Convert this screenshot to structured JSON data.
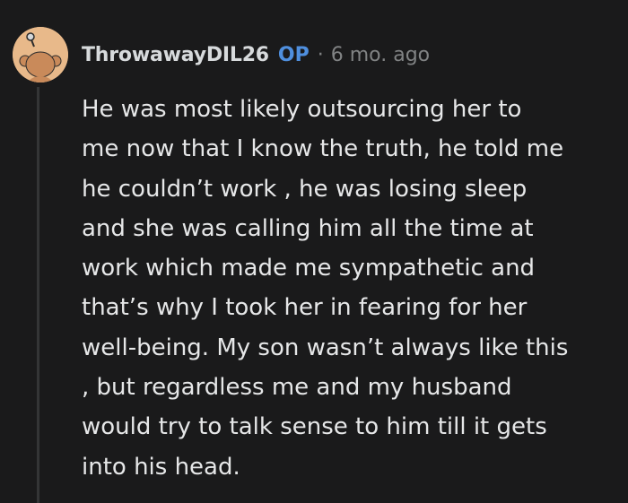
{
  "comment": {
    "username": "ThrowawayDIL26",
    "op_badge": "OP",
    "separator": "·",
    "timestamp": "6 mo. ago",
    "avatar_icon": "snoo-avatar-icon",
    "body_lines": [
      "He was most likely outsourcing her to",
      "me now that I know the truth, he told me",
      "he couldn’t work , he was losing sleep",
      "and she was calling him all the time at",
      "work which made me sympathetic and",
      "that’s why I took her in fearing for her",
      "well-being. My son wasn’t always like this",
      ", but regardless me and my husband",
      "would try to talk sense to him till it gets",
      "into his head."
    ]
  },
  "colors": {
    "background": "#1a1a1b",
    "text": "#e6e7e8",
    "op_badge": "#4f8fde",
    "meta": "#818384",
    "thread_line": "#343536",
    "avatar_bg": "#e8b98a"
  }
}
